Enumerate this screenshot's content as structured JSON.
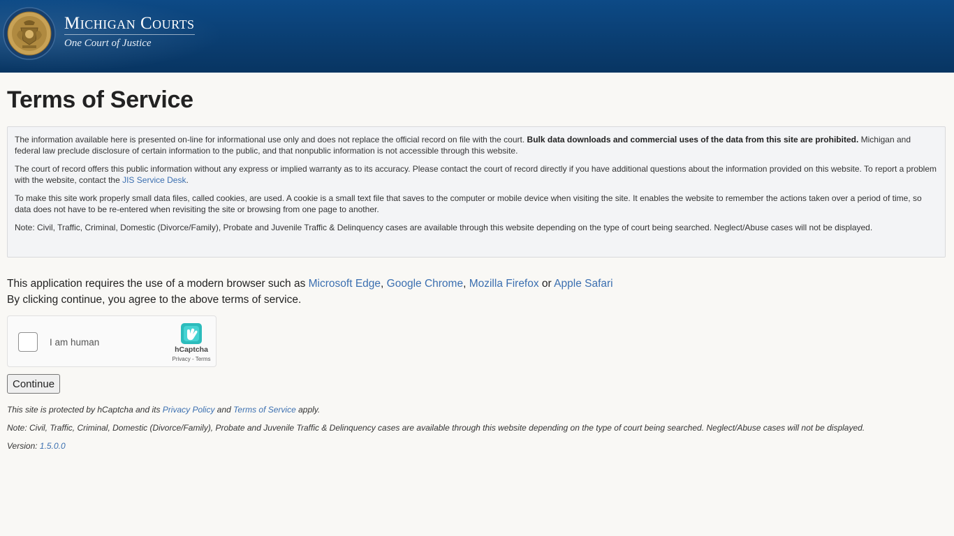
{
  "header": {
    "title": "Michigan Courts",
    "subtitle": "One Court of Justice",
    "seal_alt": "The Great Seal of the State of Michigan"
  },
  "page": {
    "title": "Terms of Service"
  },
  "terms": {
    "p1_intro": "The information available here is presented on-line for informational use only and does not replace the official record on file with the court. ",
    "p1_bold": "Bulk data downloads and commercial uses of the data from this site are prohibited.",
    "p1_rest": " Michigan and federal law preclude disclosure of certain information to the public, and that nonpublic information is not accessible through this website.",
    "p2_intro": "The court of record offers this public information without any express or implied warranty as to its accuracy. Please contact the court of record directly if you have additional questions about the information provided on this website. To report a problem with the website, contact the ",
    "p2_link": "JIS Service Desk",
    "p2_end": ".",
    "p3": "To make this site work properly small data files, called cookies, are used. A cookie is a small text file that saves to the computer or mobile device when visiting the site. It enables the website to remember the actions taken over a period of time, so data does not have to be re-entered when revisiting the site or browsing from one page to another.",
    "p4": "Note: Civil, Traffic, Criminal, Domestic (Divorce/Family), Probate and Juvenile Traffic & Delinquency cases are available through this website depending on the type of court being searched. Neglect/Abuse cases will not be displayed."
  },
  "browsers": {
    "intro": "This application requires the use of a modern browser such as ",
    "edge": "Microsoft Edge",
    "sep1": ", ",
    "chrome": "Google Chrome",
    "sep2": ", ",
    "firefox": "Mozilla Firefox",
    "or": " or ",
    "safari": "Apple Safari"
  },
  "agree_text": "By clicking continue, you agree to the above terms of service.",
  "captcha": {
    "label": "I am human",
    "brand": "hCaptcha",
    "privacy": "Privacy",
    "dash": " - ",
    "terms": "Terms"
  },
  "continue_label": "Continue",
  "footer": {
    "protected_intro": "This site is protected by hCaptcha and its ",
    "privacy_policy": "Privacy Policy",
    "and": " and ",
    "terms_of_service": "Terms of Service",
    "apply": " apply.",
    "note": "Note: Civil, Traffic, Criminal, Domestic (Divorce/Family), Probate and Juvenile Traffic & Delinquency cases are available through this website depending on the type of court being searched. Neglect/Abuse cases will not be displayed.",
    "version_label": "Version: ",
    "version": "1.5.0.0"
  },
  "colors": {
    "header_blue": "#0a3d70",
    "link": "#3b6fb0",
    "background": "#f9f8f5"
  }
}
